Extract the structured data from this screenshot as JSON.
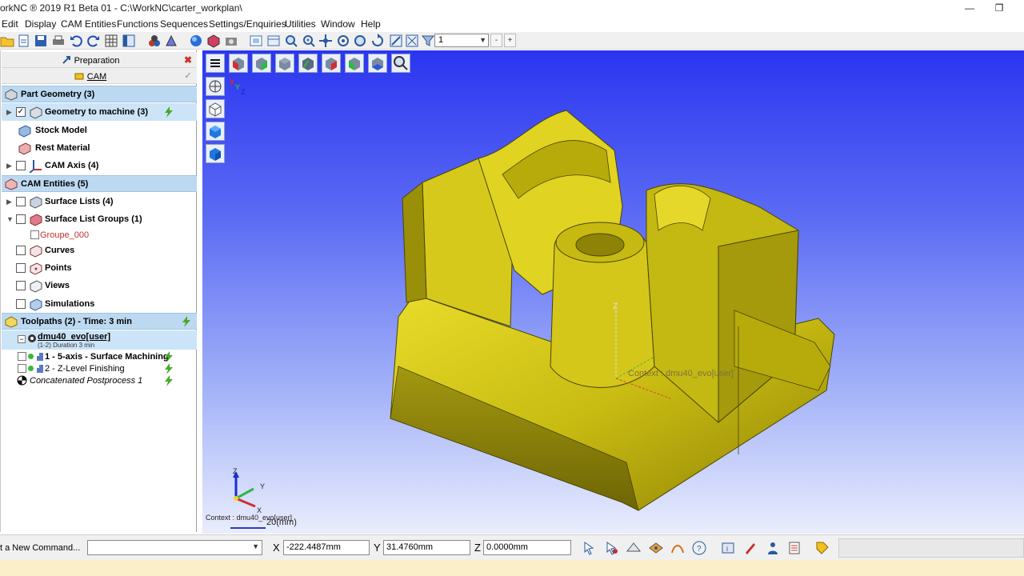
{
  "window": {
    "title": "orkNC ® 2019 R1 Beta 01 - C:\\WorkNC\\carter_workplan\\",
    "minimize": "—",
    "maximize": "❐"
  },
  "menu": [
    "Edit",
    "Display",
    "CAM Entities",
    "Functions",
    "Sequences",
    "Settings/Enquiries",
    "Utilities",
    "Window",
    "Help"
  ],
  "toolbar": {
    "layer_value": "1",
    "minus": "-",
    "plus": "+"
  },
  "panel": {
    "tab_preparation": "Preparation",
    "tab_cam": "CAM",
    "part_geometry": "Part Geometry (3)",
    "geometry_to_machine": "Geometry to machine (3)",
    "stock_model": "Stock Model",
    "rest_material": "Rest Material",
    "cam_axis": "CAM Axis (4)",
    "cam_entities": "CAM Entities (5)",
    "surface_lists": "Surface Lists (4)",
    "surface_list_groups": "Surface List Groups (1)",
    "groupe": "Groupe_000",
    "curves": "Curves",
    "points": "Points",
    "views": "Views",
    "simulations": "Simulations",
    "toolpaths": "Toolpaths (2) - Time: 3 min",
    "machine_name": "dmu40_evo[user]",
    "machine_sub": "(1-2) Duration 3 min",
    "tp1": "1 - 5-axis - Surface Machining",
    "tp2": "2 - Z-Level Finishing",
    "postprocess": "Concatenated Postprocess 1"
  },
  "viewport": {
    "context_label": "Context : dmu40_evo[user]",
    "context_bottom": "Context : dmu40_evo[user]",
    "scale": "20(mm)",
    "axis_z": "Z",
    "axis_y": "Y",
    "axis_x": "X",
    "part_color": "#c8bd12"
  },
  "cmdbar": {
    "label": "t a New Command...",
    "x_label": "X",
    "x_value": "-222.4487mm",
    "y_label": "Y",
    "y_value": "31.4760mm",
    "z_label": "Z",
    "z_value": "0.0000mm"
  }
}
